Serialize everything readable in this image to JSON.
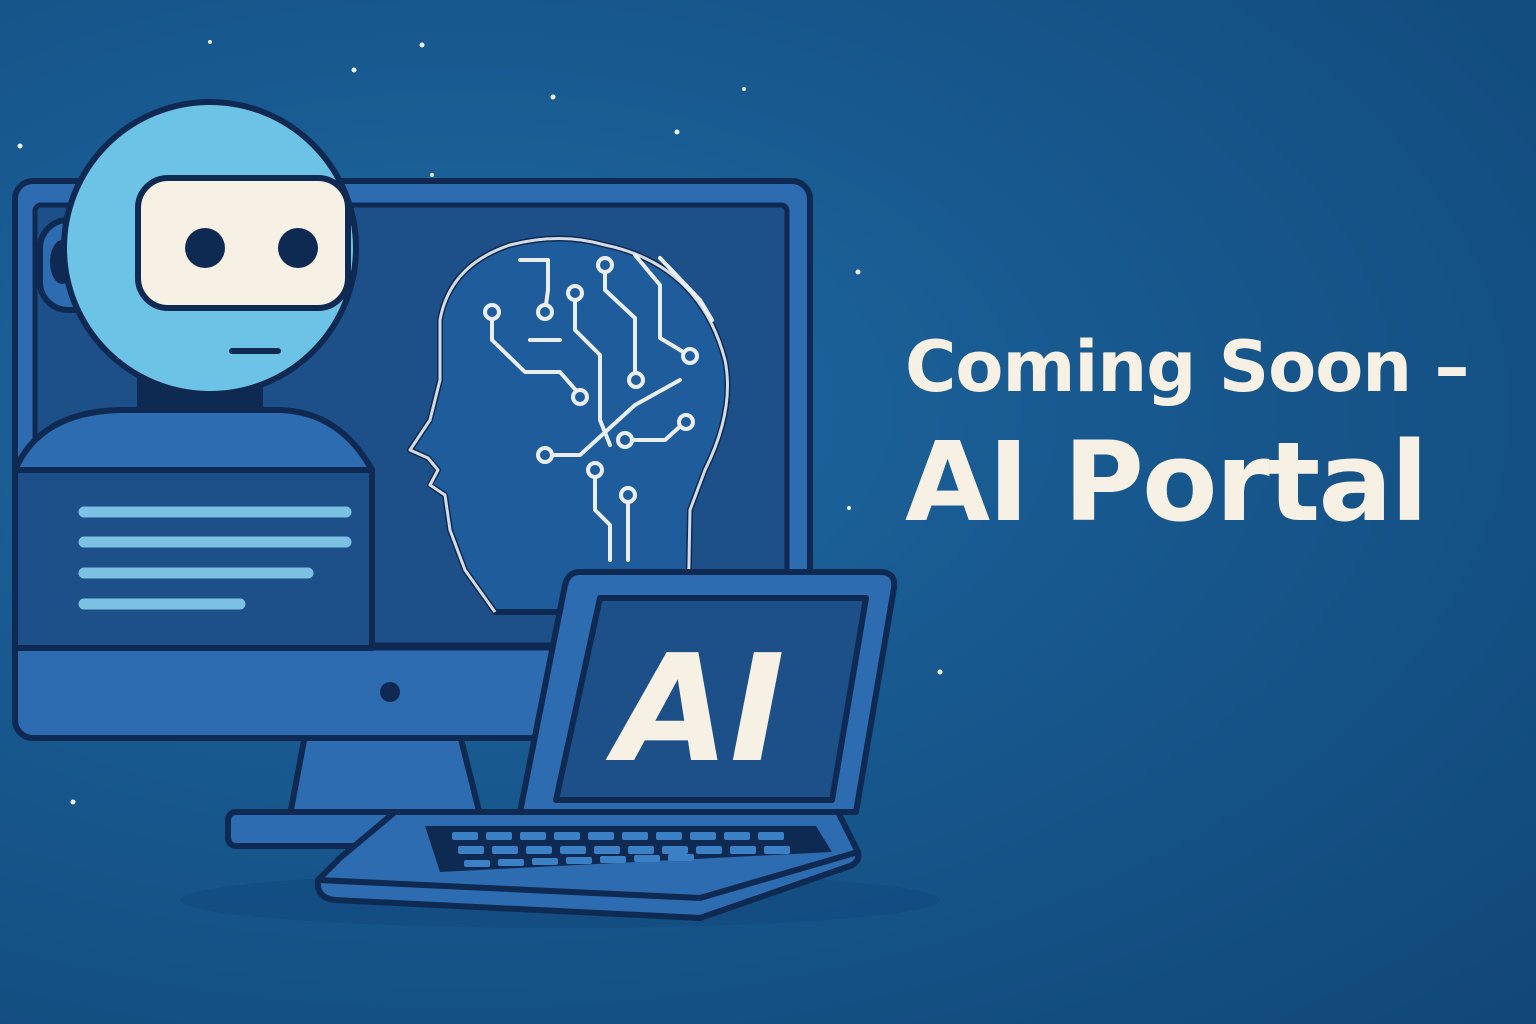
{
  "headline": {
    "line1": "Coming Soon –",
    "line2": "AI Portal"
  },
  "laptop": {
    "screen_text": "AI"
  },
  "icons": [
    "robot-icon",
    "monitor-icon",
    "head-circuit-icon",
    "laptop-icon",
    "keyboard-icon"
  ],
  "colors": {
    "background": "#17588e",
    "outline": "#0f2a52",
    "robot_head": "#6cc3e6",
    "visor": "#f6f1e4",
    "monitor_body": "#2d6cb0",
    "monitor_screen": "#1c4f8a",
    "text": "#f6f1e4",
    "text_lines": "#7cc0e4"
  }
}
